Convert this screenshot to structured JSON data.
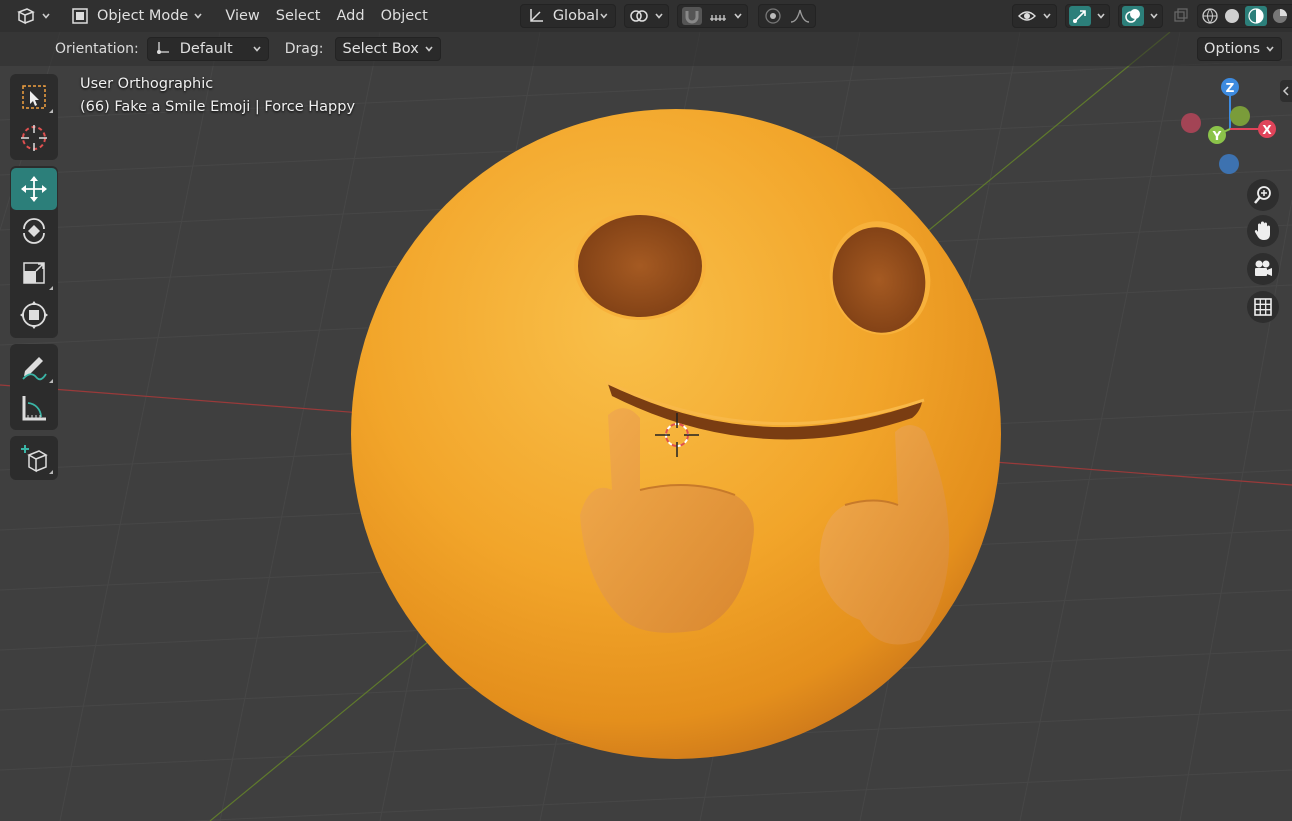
{
  "header": {
    "mode_label": "Object Mode",
    "menus": [
      "View",
      "Select",
      "Add",
      "Object"
    ],
    "transform_orientation": "Global"
  },
  "tool_settings": {
    "orientation_label": "Orientation:",
    "orientation_value": "Default",
    "drag_label": "Drag:",
    "drag_value": "Select Box",
    "options_label": "Options"
  },
  "viewport": {
    "view_name": "User Orthographic",
    "object_info": "(66) Fake a Smile Emoji | Force Happy"
  },
  "gizmo": {
    "x_label": "X",
    "y_label": "Y",
    "z_label": "Z",
    "colors": {
      "x": "#e0445a",
      "y": "#8bc34a",
      "z": "#3d8be0"
    }
  },
  "tools": [
    "select-box",
    "cursor",
    "move",
    "rotate",
    "scale",
    "transform",
    "annotate",
    "measure",
    "add-cube"
  ],
  "colors": {
    "accent": "#2c7f7a",
    "emoji": "#f2a52a"
  }
}
